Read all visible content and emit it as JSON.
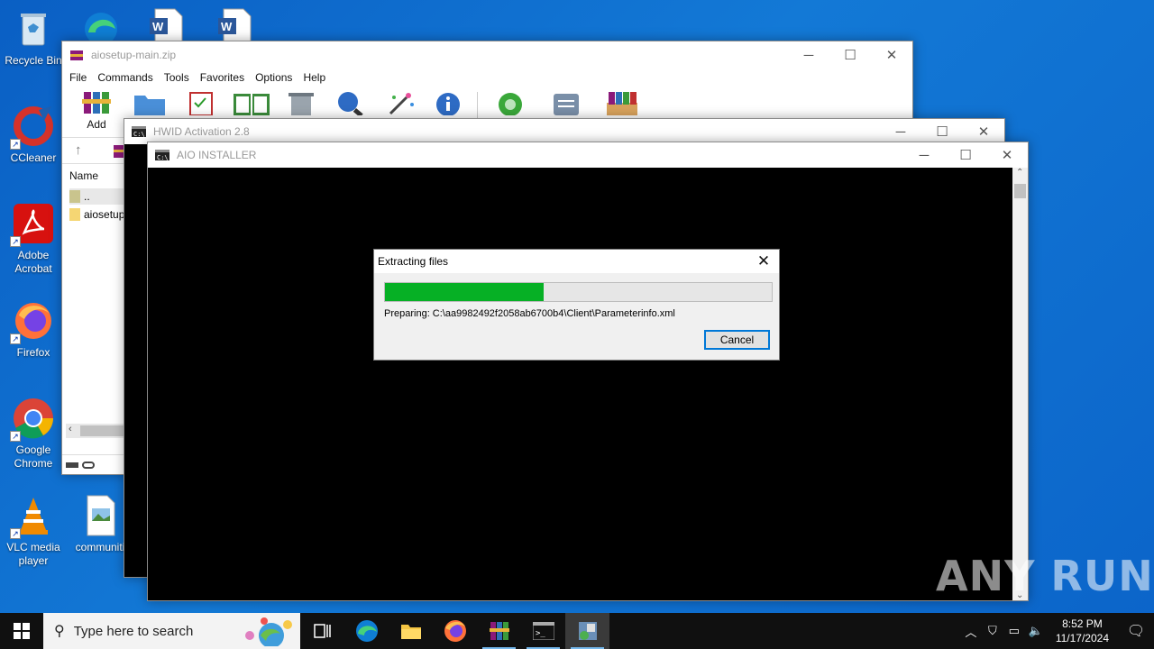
{
  "desktop": {
    "icons": [
      {
        "label": "Recycle Bin"
      },
      {
        "label": "CCleaner"
      },
      {
        "label": "Adobe Acrobat"
      },
      {
        "label": "Firefox"
      },
      {
        "label": "Google Chrome"
      },
      {
        "label": "VLC media player"
      },
      {
        "label": "communiti"
      }
    ]
  },
  "winrar": {
    "title": "aiosetup-main.zip",
    "menu": [
      "File",
      "Commands",
      "Tools",
      "Favorites",
      "Options",
      "Help"
    ],
    "toolbar_add_label": "Add",
    "column_name": "Name",
    "rows": [
      "..",
      "aiosetup"
    ]
  },
  "hwid": {
    "title": "HWID Activation 2.8"
  },
  "aio": {
    "title": "AIO INSTALLER"
  },
  "dialog": {
    "title": "Extracting files",
    "progress_percent": 41,
    "status_text": "Preparing: C:\\aa9982492f2058ab6700b4\\Client\\Parameterinfo.xml",
    "cancel_label": "Cancel"
  },
  "taskbar": {
    "search_placeholder": "Type here to search",
    "time": "8:52 PM",
    "date": "11/17/2024"
  },
  "watermark": "ANY RUN",
  "colors": {
    "progress": "#06b025",
    "desktop": "#0a5fc4",
    "accent": "#0078d7"
  }
}
